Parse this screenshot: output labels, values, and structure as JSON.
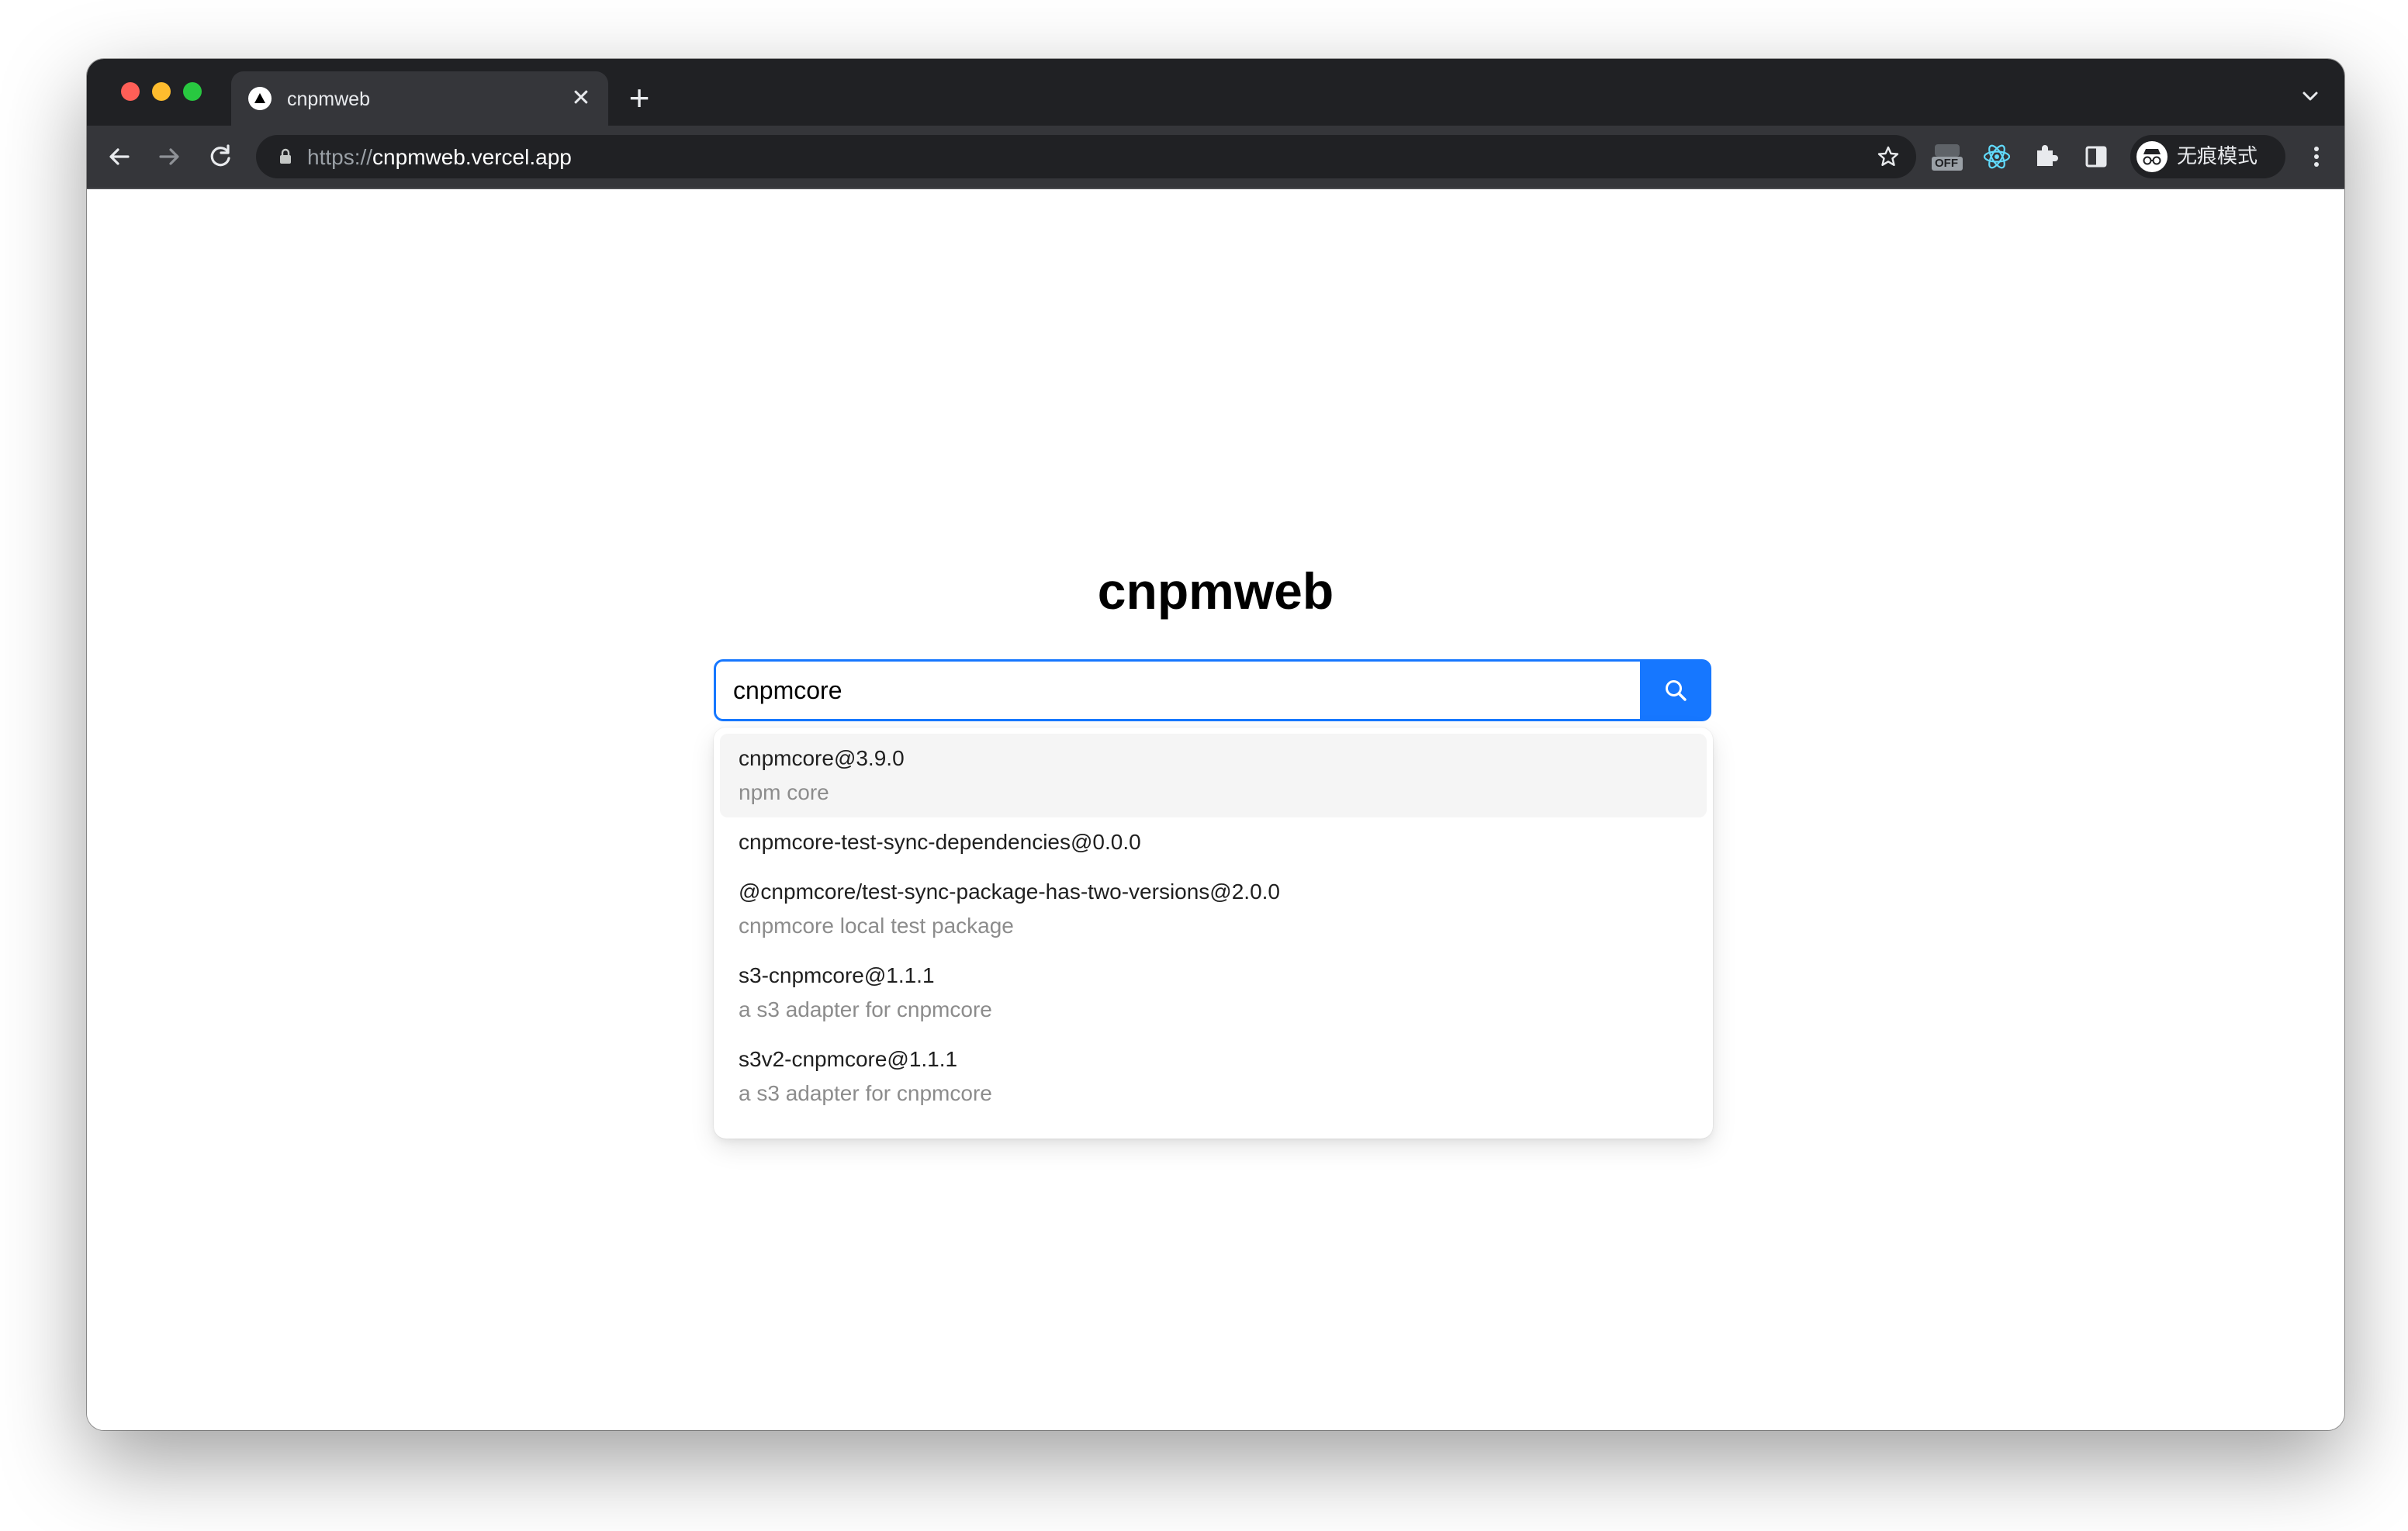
{
  "browser": {
    "tab_title": "cnpmweb",
    "url_scheme": "https://",
    "url_host": "cnpmweb.vercel.app",
    "incognito_label": "无痕模式",
    "extension_off_badge": "OFF"
  },
  "page": {
    "title": "cnpmweb",
    "search": {
      "value": "cnpmcore",
      "accent_color": "#1677ff"
    },
    "suggestions": [
      {
        "name": "cnpmcore@3.9.0",
        "description": "npm core"
      },
      {
        "name": "cnpmcore-test-sync-dependencies@0.0.0",
        "description": ""
      },
      {
        "name": "@cnpmcore/test-sync-package-has-two-versions@2.0.0",
        "description": "cnpmcore local test package"
      },
      {
        "name": "s3-cnpmcore@1.1.1",
        "description": "a s3 adapter for cnpmcore"
      },
      {
        "name": "s3v2-cnpmcore@1.1.1",
        "description": "a s3 adapter for cnpmcore"
      }
    ]
  },
  "icons": {
    "tab_favicon": "vercel-triangle-icon",
    "close": "close-icon",
    "new_tab": "plus-icon",
    "back": "arrow-left-icon",
    "forward": "arrow-right-icon",
    "reload": "reload-icon",
    "lock": "lock-icon",
    "bookmark": "star-icon",
    "search": "search-icon"
  }
}
